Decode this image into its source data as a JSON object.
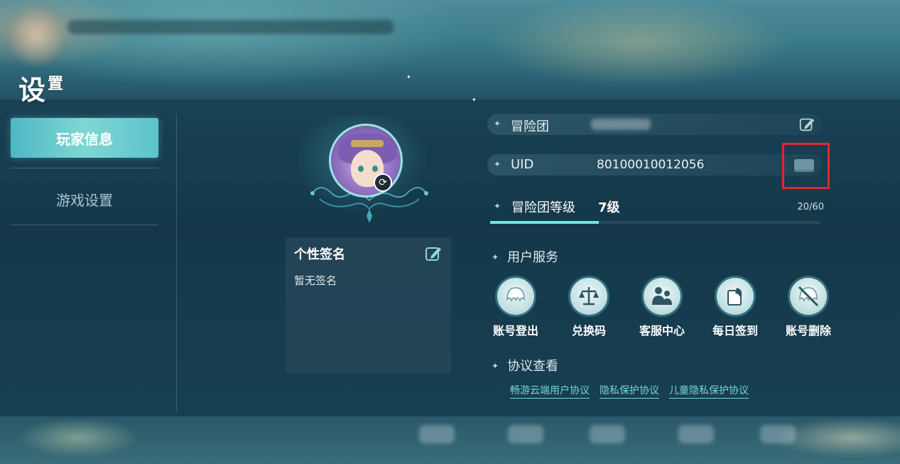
{
  "title": {
    "big": "设",
    "small": "置"
  },
  "sidebar": {
    "items": [
      {
        "label": "玩家信息",
        "active": true
      },
      {
        "label": "游戏设置",
        "active": false
      }
    ]
  },
  "signature": {
    "title": "个性签名",
    "text": "暂无签名"
  },
  "info": {
    "team": {
      "label": "冒险团",
      "value": ""
    },
    "uid": {
      "label": "UID",
      "value": "80100010012056"
    },
    "level": {
      "label": "冒险团等级",
      "value": "7级",
      "exp": "20/60",
      "progress": 0.33
    }
  },
  "services": {
    "title": "用户服务",
    "items": [
      {
        "label": "账号登出",
        "icon": "logout-icon"
      },
      {
        "label": "兑换码",
        "icon": "scale-icon"
      },
      {
        "label": "客服中心",
        "icon": "support-icon"
      },
      {
        "label": "每日签到",
        "icon": "checkin-icon"
      },
      {
        "label": "账号删除",
        "icon": "delete-account-icon"
      }
    ]
  },
  "agreements": {
    "title": "协议查看",
    "links": [
      "畅游云端用户协议",
      "隐私保护协议",
      "儿童隐私保护协议"
    ]
  },
  "colors": {
    "accent": "#6fe6e0",
    "highlight": "#e5262a",
    "link": "#74d6d9"
  }
}
